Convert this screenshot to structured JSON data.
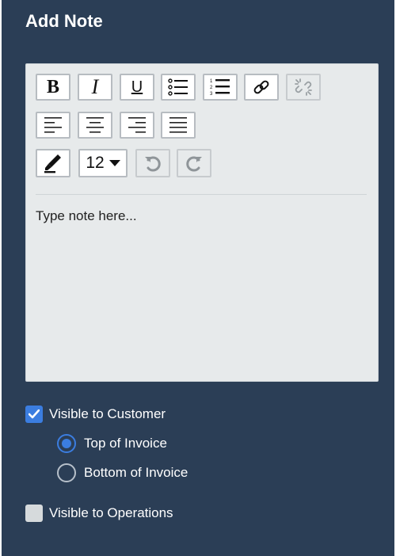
{
  "panel": {
    "title": "Add Note"
  },
  "toolbar": {
    "bold": "B",
    "italic": "I",
    "underline": "U",
    "font_size": "12"
  },
  "editor": {
    "placeholder": "Type note here..."
  },
  "options": {
    "visible_to_customer": {
      "label": "Visible to Customer",
      "checked": true
    },
    "placement": [
      {
        "label": "Top of Invoice",
        "selected": true
      },
      {
        "label": "Bottom of Invoice",
        "selected": false
      }
    ],
    "visible_to_operations": {
      "label": "Visible to Operations",
      "checked": false
    }
  },
  "colors": {
    "panel_bg": "#2b3e56",
    "accent": "#3b7de0",
    "editor_bg": "#e7eaeb"
  }
}
